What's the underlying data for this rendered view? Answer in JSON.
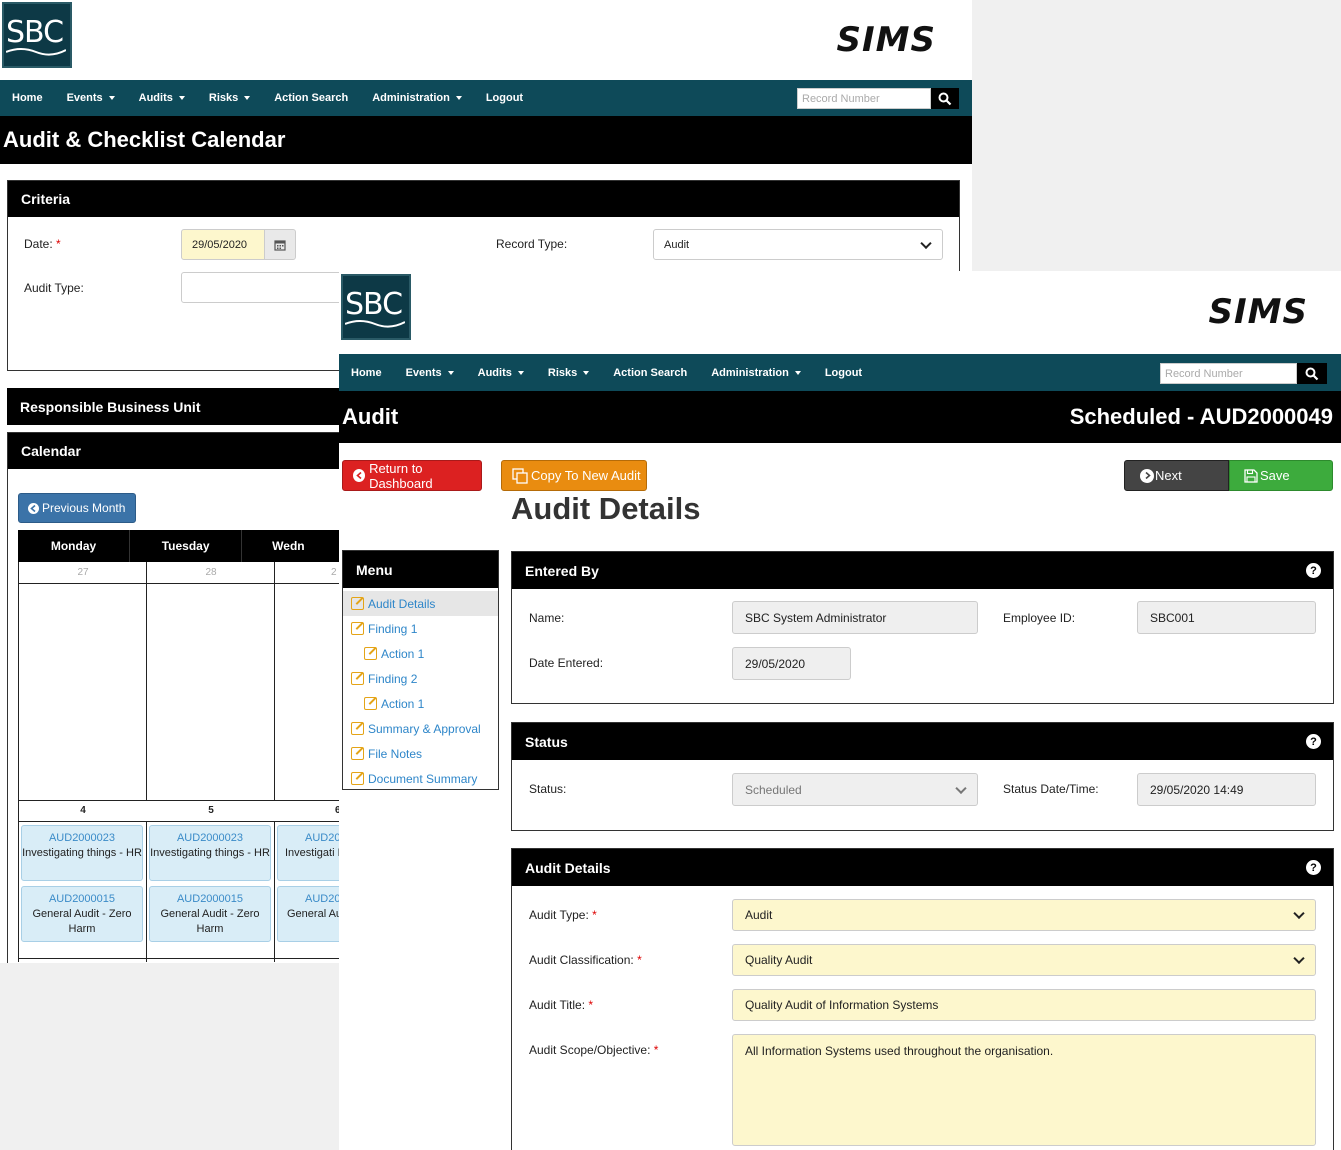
{
  "header": {
    "logo_text": "SBC",
    "brand": "SIMS"
  },
  "nav": {
    "items": [
      "Home",
      "Events",
      "Audits",
      "Risks",
      "Action Search",
      "Administration",
      "Logout"
    ],
    "search_placeholder": "Record Number"
  },
  "calendar_page": {
    "title": "Audit & Checklist Calendar",
    "criteria": {
      "heading": "Criteria",
      "date_label": "Date:",
      "date_value": "29/05/2020",
      "record_type_label": "Record Type:",
      "record_type_value": "Audit",
      "audit_type_label": "Audit Type:"
    },
    "business_unit_heading": "Responsible Business Unit",
    "calendar_heading": "Calendar",
    "prev_month": "Previous Month",
    "days": [
      "Monday",
      "Tuesday",
      "Wedn"
    ],
    "week1_dates": [
      "27",
      "28",
      "2"
    ],
    "week2_dates": [
      "4",
      "5",
      "6"
    ],
    "events": [
      {
        "id": "AUD2000023",
        "title": "Investigating things - HR"
      },
      {
        "id": "AUD2000023",
        "title": "Investigating things - HR"
      },
      {
        "id": "AUD20",
        "title": "Investigati H"
      },
      {
        "id": "AUD2000015",
        "title": "General Audit - Zero Harm"
      },
      {
        "id": "AUD2000015",
        "title": "General Audit - Zero Harm"
      },
      {
        "id": "AUD20",
        "title": "General Au Ha"
      }
    ]
  },
  "audit_page": {
    "title": "Audit",
    "record_status": "Scheduled - AUD2000049",
    "buttons": {
      "return": "Return to Dashboard",
      "copy": "Copy To New Audit",
      "next": "Next",
      "save": "Save"
    },
    "heading": "Audit Details",
    "menu": {
      "heading": "Menu",
      "items": [
        "Audit Details",
        "Finding 1",
        "Action 1",
        "Finding 2",
        "Action 1",
        "Summary & Approval",
        "File Notes",
        "Document Summary"
      ]
    },
    "entered_by": {
      "heading": "Entered By",
      "name_label": "Name:",
      "name_value": "SBC System Administrator",
      "emp_label": "Employee ID:",
      "emp_value": "SBC001",
      "date_label": "Date Entered:",
      "date_value": "29/05/2020"
    },
    "status": {
      "heading": "Status",
      "status_label": "Status:",
      "status_value": "Scheduled",
      "datetime_label": "Status Date/Time:",
      "datetime_value": "29/05/2020 14:49"
    },
    "details": {
      "heading": "Audit Details",
      "type_label": "Audit Type:",
      "type_value": "Audit",
      "class_label": "Audit Classification:",
      "class_value": "Quality Audit",
      "title_label": "Audit Title:",
      "title_value": "Quality Audit of Information Systems",
      "scope_label": "Audit Scope/Objective:",
      "scope_value": "All Information Systems used throughout the organisation."
    }
  }
}
